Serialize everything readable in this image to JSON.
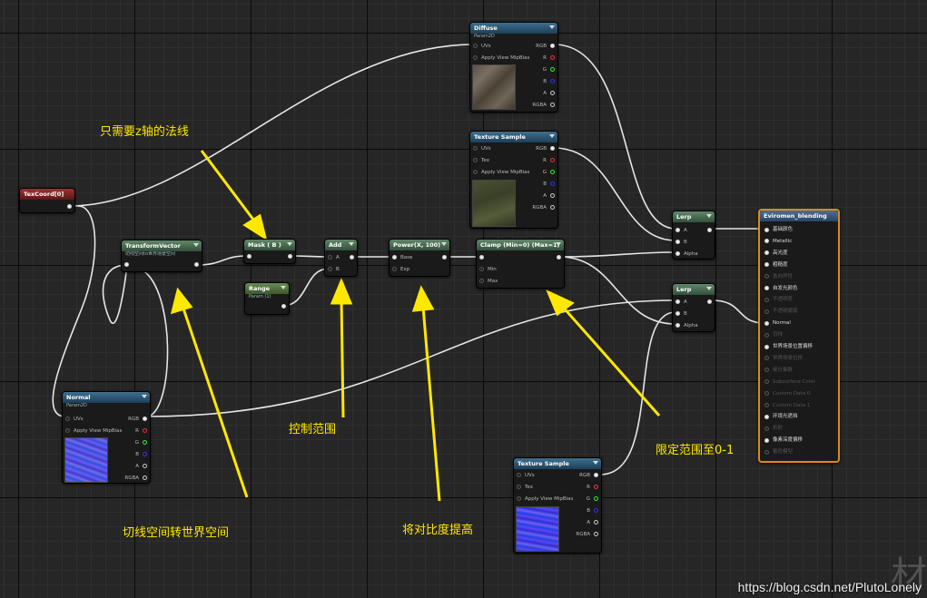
{
  "nodes": {
    "diffuse": {
      "title": "Diffuse",
      "sub": "Param2D",
      "pins_in": [
        "UVs",
        "Apply View MipBias"
      ],
      "pins_out": [
        "RGB",
        "R",
        "G",
        "B",
        "A",
        "RGBA"
      ]
    },
    "texture_sample_1": {
      "title": "Texture Sample",
      "pins_in": [
        "UVs",
        "Tex",
        "Apply View MipBias"
      ],
      "pins_out": [
        "RGB",
        "R",
        "G",
        "B",
        "A",
        "RGBA"
      ]
    },
    "texture_sample_2": {
      "title": "Texture Sample",
      "pins_in": [
        "UVs",
        "Tex",
        "Apply View MipBias"
      ],
      "pins_out": [
        "RGB",
        "R",
        "G",
        "B",
        "A",
        "RGBA"
      ]
    },
    "normal": {
      "title": "Normal",
      "sub": "Param2D",
      "pins_in": [
        "UVs",
        "Apply View MipBias"
      ],
      "pins_out": [
        "RGB",
        "R",
        "G",
        "B",
        "A",
        "RGBA"
      ]
    },
    "texcoord": {
      "title": "TexCoord[0]"
    },
    "transform_vector": {
      "title": "TransformVector",
      "sub": "切线空间to世界场景空间"
    },
    "mask": {
      "title": "Mask ( B )"
    },
    "range": {
      "title": "Range",
      "sub": "Param (1)"
    },
    "add": {
      "title": "Add",
      "pins_in": [
        "A",
        "B"
      ]
    },
    "power": {
      "title": "Power(X, 100)",
      "pins_in": [
        "Base",
        "Exp"
      ]
    },
    "clamp": {
      "title": "Clamp (Min=0) (Max=1)",
      "pins_in": [
        "Min",
        "Max"
      ]
    },
    "lerp1": {
      "title": "Lerp",
      "pins_in": [
        "A",
        "B",
        "Alpha"
      ]
    },
    "lerp2": {
      "title": "Lerp",
      "pins_in": [
        "A",
        "B",
        "Alpha"
      ]
    },
    "material": {
      "title": "Eviromen_blending",
      "inputs": [
        {
          "label": "基础颜色",
          "active": true
        },
        {
          "label": "Metallic",
          "active": true
        },
        {
          "label": "高光度",
          "active": true
        },
        {
          "label": "粗糙度",
          "active": true
        },
        {
          "label": "各向异性",
          "active": false
        },
        {
          "label": "自发光颜色",
          "active": true
        },
        {
          "label": "不透明度",
          "active": false
        },
        {
          "label": "不透明蒙版",
          "active": false
        },
        {
          "label": "Normal",
          "active": true
        },
        {
          "label": "切线",
          "active": false
        },
        {
          "label": "世界场景位置偏移",
          "active": true
        },
        {
          "label": "世界场景位移",
          "active": false
        },
        {
          "label": "细分乘数",
          "active": false
        },
        {
          "label": "Subsurface Color",
          "active": false
        },
        {
          "label": "Custom Data 0",
          "active": false
        },
        {
          "label": "Custom Data 1",
          "active": false
        },
        {
          "label": "环境光遮挡",
          "active": true
        },
        {
          "label": "折射",
          "active": false
        },
        {
          "label": "像素深度偏移",
          "active": true
        },
        {
          "label": "着色模型",
          "active": false
        }
      ]
    }
  },
  "annotations": {
    "z_normal": "只需要z轴的法线",
    "tangent_to_world": "切线空间转世界空间",
    "control_range": "控制范围",
    "contrast": "将对比度提高",
    "clamp_range": "限定范围至0-1"
  },
  "watermark": "https://blog.csdn.net/PlutoLonely",
  "watermark_glyph": "材",
  "colors": {
    "annotation": "#ffe800",
    "wire": "#e8e8e8",
    "material_border": "#d98b1c"
  }
}
